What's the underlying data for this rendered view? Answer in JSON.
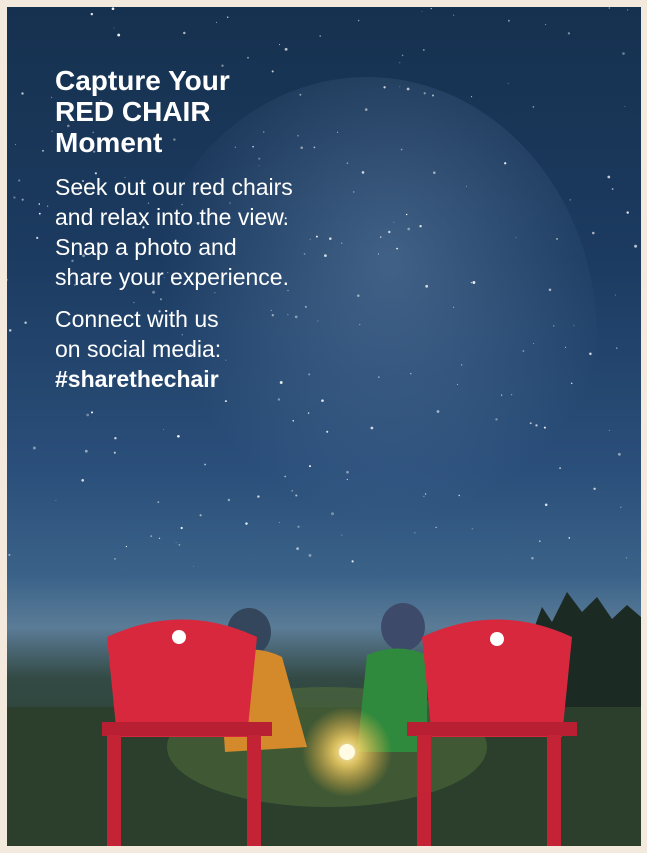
{
  "headline": {
    "line1": "Capture Your",
    "line2": "RED CHAIR",
    "line3": "Moment"
  },
  "body": {
    "line1": "Seek out our red chairs",
    "line2": "and relax into the view.",
    "line3": "Snap a photo and",
    "line4": "share your experience."
  },
  "social": {
    "line1": "Connect with us",
    "line2": "on social media:",
    "hashtag": "#sharethechair"
  },
  "colors": {
    "sky_top": "#16314f",
    "chair_red": "#d8283d",
    "text": "#ffffff"
  }
}
